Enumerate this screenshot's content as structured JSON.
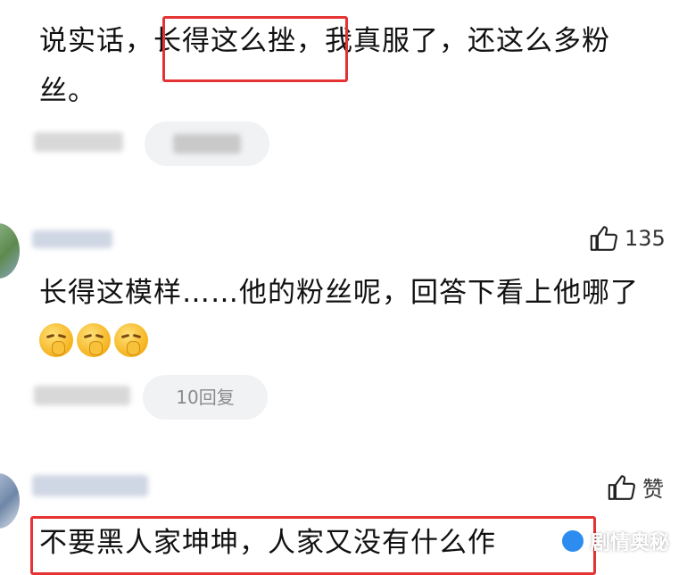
{
  "comments": [
    {
      "text": "说实话，长得这么挫，我真服了，还这么多粉丝。",
      "highlight_color": "#e53333"
    },
    {
      "text": "长得这模样……他的粉丝呢，回答下看上他哪了",
      "likes": "135",
      "replies": "10回复"
    },
    {
      "text": "不要黑人家坤坤，人家又没有什么作",
      "likes": "赞"
    }
  ],
  "watermark": {
    "text": "剧情奥秘"
  },
  "icons": {
    "like": "thumbs-up-icon",
    "emoji": "shush-emoji-icon"
  }
}
